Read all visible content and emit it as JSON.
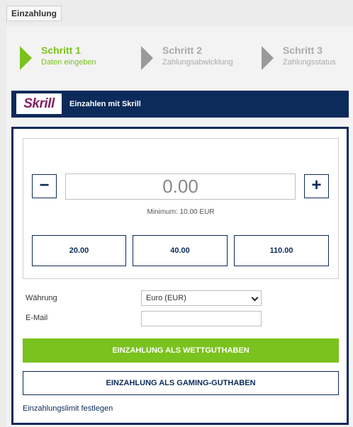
{
  "tab": {
    "label": "Einzahlung"
  },
  "steps": [
    {
      "title": "Schritt 1",
      "subtitle": "Daten eingeben"
    },
    {
      "title": "Schritt 2",
      "subtitle": "Zahlungsabwicklung"
    },
    {
      "title": "Schritt 3",
      "subtitle": "Zahlungsstatus"
    }
  ],
  "provider": {
    "logo_text": "Skrill",
    "title": "Einzahlen mit Skrill"
  },
  "amount": {
    "value": "0.00",
    "minus": "−",
    "plus": "+",
    "minimum": "Minimum: 10.00 EUR",
    "presets": [
      "20.00",
      "40.00",
      "110.00"
    ]
  },
  "form": {
    "currency_label": "Währung",
    "currency_value": "Euro (EUR)",
    "email_label": "E-Mail",
    "email_value": ""
  },
  "buttons": {
    "primary": "EINZAHLUNG ALS WETTGUTHABEN",
    "secondary": "EINZAHLUNG ALS GAMING-GUTHABEN"
  },
  "limit_link": "Einzahlungslimit festlegen",
  "colors": {
    "accent": "#7ac21d",
    "navy": "#0c2a5a",
    "brand": "#862165"
  }
}
